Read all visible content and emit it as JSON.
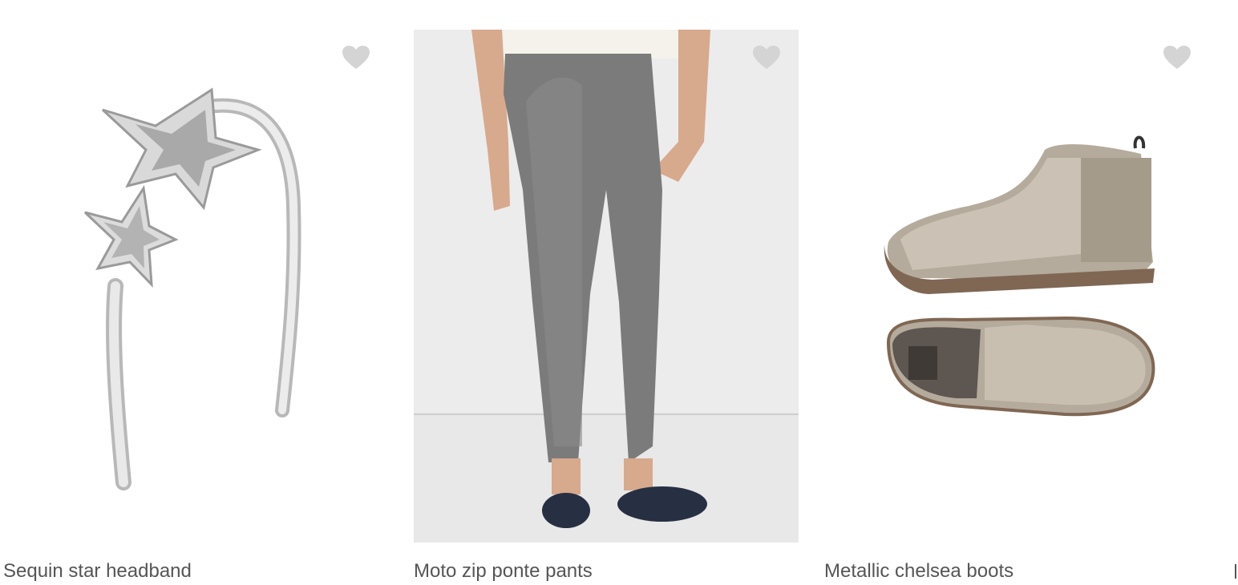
{
  "products": [
    {
      "title": "Sequin star headband"
    },
    {
      "title": "Moto zip ponte pants"
    },
    {
      "title": "Metallic chelsea boots"
    },
    {
      "title": ""
    }
  ],
  "icons": {
    "favorite": "heart-icon"
  },
  "colors": {
    "title_text": "#555555",
    "heart": "#d4d4d4"
  }
}
